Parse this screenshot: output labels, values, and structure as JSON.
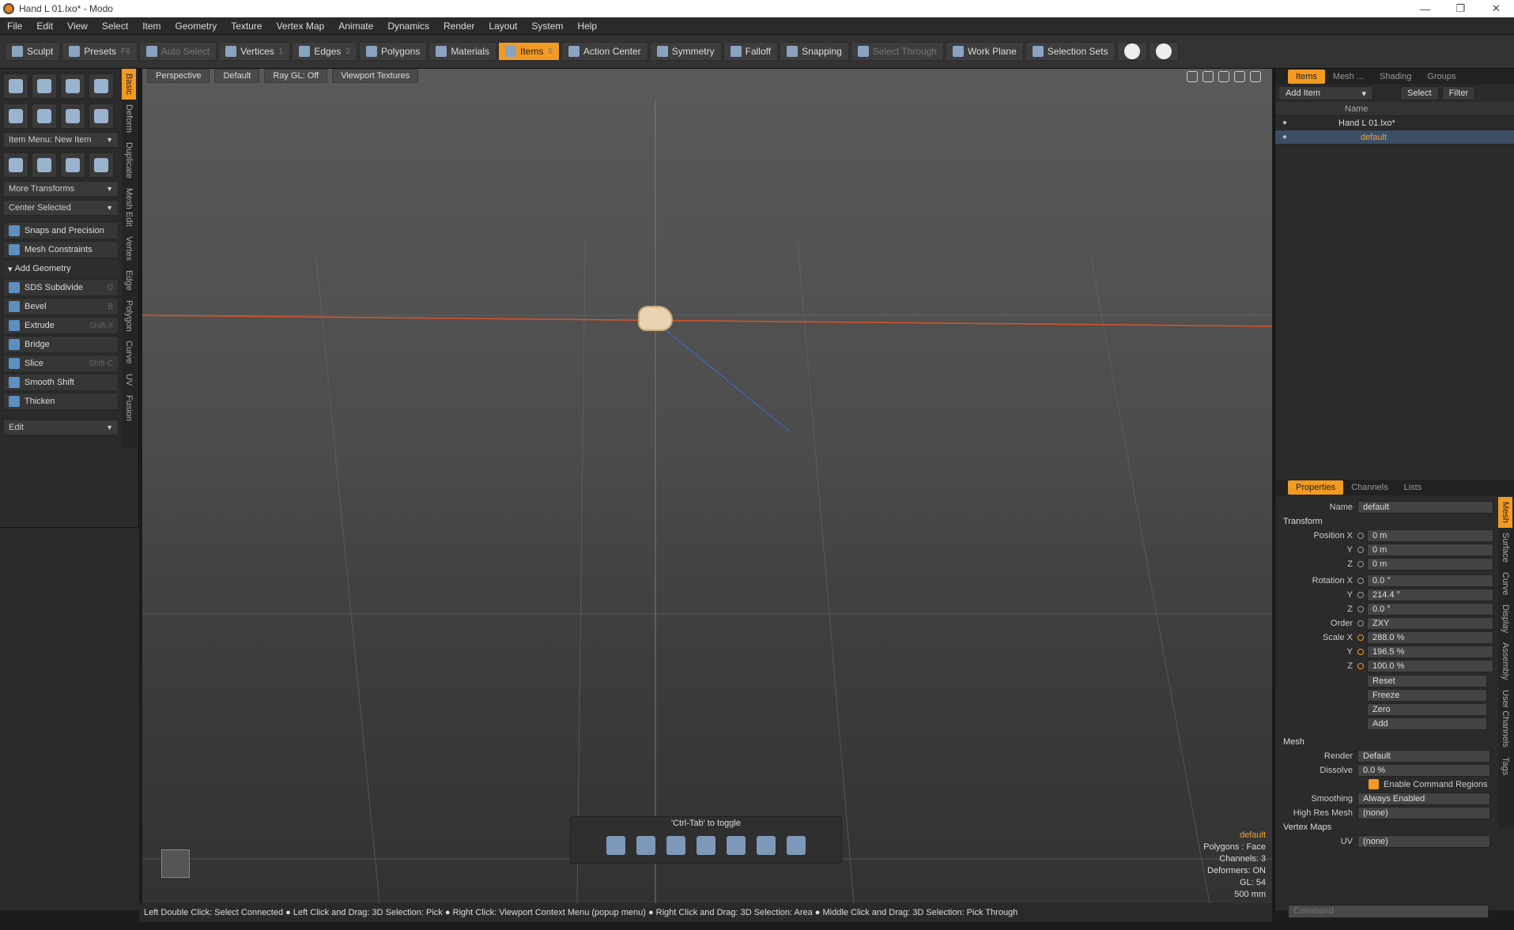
{
  "window": {
    "title": "Hand L 01.lxo* - Modo",
    "minimize": "—",
    "restore": "❐",
    "close": "✕"
  },
  "menu": [
    "File",
    "Edit",
    "View",
    "Select",
    "Item",
    "Geometry",
    "Texture",
    "Vertex Map",
    "Animate",
    "Dynamics",
    "Render",
    "Layout",
    "System",
    "Help"
  ],
  "toolbar": {
    "sculpt": "Sculpt",
    "presets": "Presets",
    "presets_key": "F6",
    "auto_select": "Auto Select",
    "vertices": "Vertices",
    "vertices_key": "1",
    "edges": "Edges",
    "edges_key": "2",
    "polygons": "Polygons",
    "materials": "Materials",
    "items": "Items",
    "items_key": "5",
    "action_center": "Action Center",
    "symmetry": "Symmetry",
    "falloff": "Falloff",
    "snapping": "Snapping",
    "select_through": "Select Through",
    "work_plane": "Work Plane",
    "selection_sets": "Selection Sets"
  },
  "left_panel": {
    "item_menu": "Item Menu: New Item",
    "more_transforms": "More Transforms",
    "center_selected": "Center Selected",
    "snaps": "Snaps and Precision",
    "mesh_constraints": "Mesh Constraints",
    "add_geometry": "Add Geometry",
    "tools": [
      {
        "label": "SDS Subdivide",
        "key": "D"
      },
      {
        "label": "Bevel",
        "key": "B"
      },
      {
        "label": "Extrude",
        "key": "Shift-X"
      },
      {
        "label": "Bridge",
        "key": ""
      },
      {
        "label": "Slice",
        "key": "Shift-C"
      },
      {
        "label": "Smooth Shift",
        "key": ""
      },
      {
        "label": "Thicken",
        "key": ""
      }
    ],
    "edit": "Edit",
    "vtabs": [
      "Basic",
      "Deform",
      "Duplicate",
      "Mesh Edit",
      "Vertex",
      "Edge",
      "Polygon",
      "Curve",
      "UV",
      "Fusion"
    ]
  },
  "viewport": {
    "tabs": [
      "Perspective",
      "Default",
      "Ray GL: Off",
      "Viewport Textures"
    ],
    "toggle_hint": "'Ctrl-Tab' to toggle",
    "info": {
      "selected": "default",
      "polygons": "Polygons : Face",
      "channels": "Channels: 3",
      "deformers": "Deformers: ON",
      "gl": "GL: 54",
      "scale": "500 mm"
    }
  },
  "status": "Left Double Click: Select Connected ● Left Click and Drag: 3D Selection: Pick ● Right Click: Viewport Context Menu (popup menu) ● Right Click and Drag: 3D Selection: Area ● Middle Click and Drag: 3D Selection: Pick Through",
  "items_panel": {
    "tabs": [
      "Items",
      "Mesh ...",
      "Shading",
      "Groups"
    ],
    "add_item": "Add Item",
    "select": "Select",
    "filter": "Filter",
    "name_col": "Name",
    "scene": "Hand L 01.lxo*",
    "mesh": "default"
  },
  "properties": {
    "tabs": [
      "Properties",
      "Channels",
      "Lists"
    ],
    "name_label": "Name",
    "name_value": "default",
    "transform": "Transform",
    "position_label": "Position X",
    "pos": [
      "0 m",
      "0 m",
      "0 m"
    ],
    "rotation_label": "Rotation X",
    "rot": [
      "0.0 °",
      "214.4 °",
      "0.0 °"
    ],
    "order_label": "Order",
    "order": "ZXY",
    "scale_label": "Scale X",
    "scale": [
      "288.0 %",
      "196.5 %",
      "100.0 %"
    ],
    "y": "Y",
    "z": "Z",
    "actions": [
      "Reset",
      "Freeze",
      "Zero",
      "Add"
    ],
    "mesh": "Mesh",
    "render_label": "Render",
    "render": "Default",
    "dissolve_label": "Dissolve",
    "dissolve": "0.0 %",
    "cmd_regions": "Enable Command Regions",
    "smoothing_label": "Smoothing",
    "smoothing": "Always Enabled",
    "hires_label": "High Res Mesh",
    "hires": "(none)",
    "vertex_maps": "Vertex Maps",
    "uv_label": "UV",
    "uv": "(none)",
    "side_tabs": [
      "Mesh",
      "Surface",
      "Curve",
      "Display",
      "Assembly",
      "User Channels",
      "Tags"
    ]
  },
  "command_placeholder": "Command",
  "colors": {
    "accent": "#f29a22",
    "red_axis": "#d9552a",
    "blue_axis": "#3b6fd0"
  }
}
